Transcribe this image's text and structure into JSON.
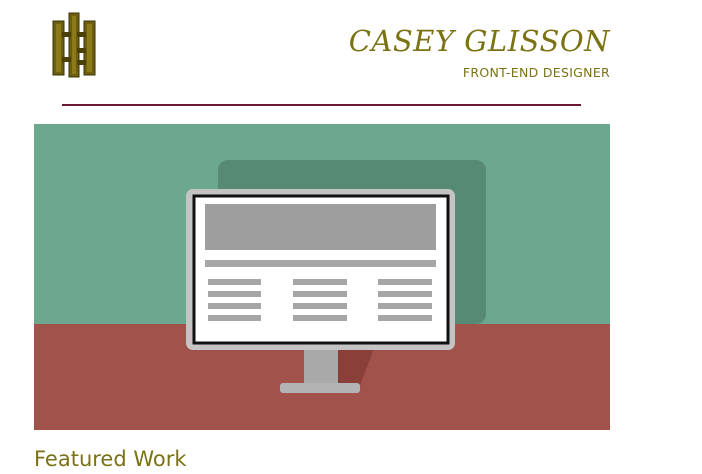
{
  "header": {
    "brand_name": "CASEY GLISSON",
    "brand_title": "FRONT-END DESIGNER",
    "logo_icon": "cg-monogram-logo"
  },
  "hero": {
    "illustration": "desktop-monitor-wireframe-icon"
  },
  "main": {
    "section_title": "Featured Work"
  },
  "colors": {
    "accent": "#7a7214",
    "divider": "#6b1633",
    "wall": "#6ba88d",
    "floor": "#a1524a",
    "shadow": "#578a72"
  }
}
